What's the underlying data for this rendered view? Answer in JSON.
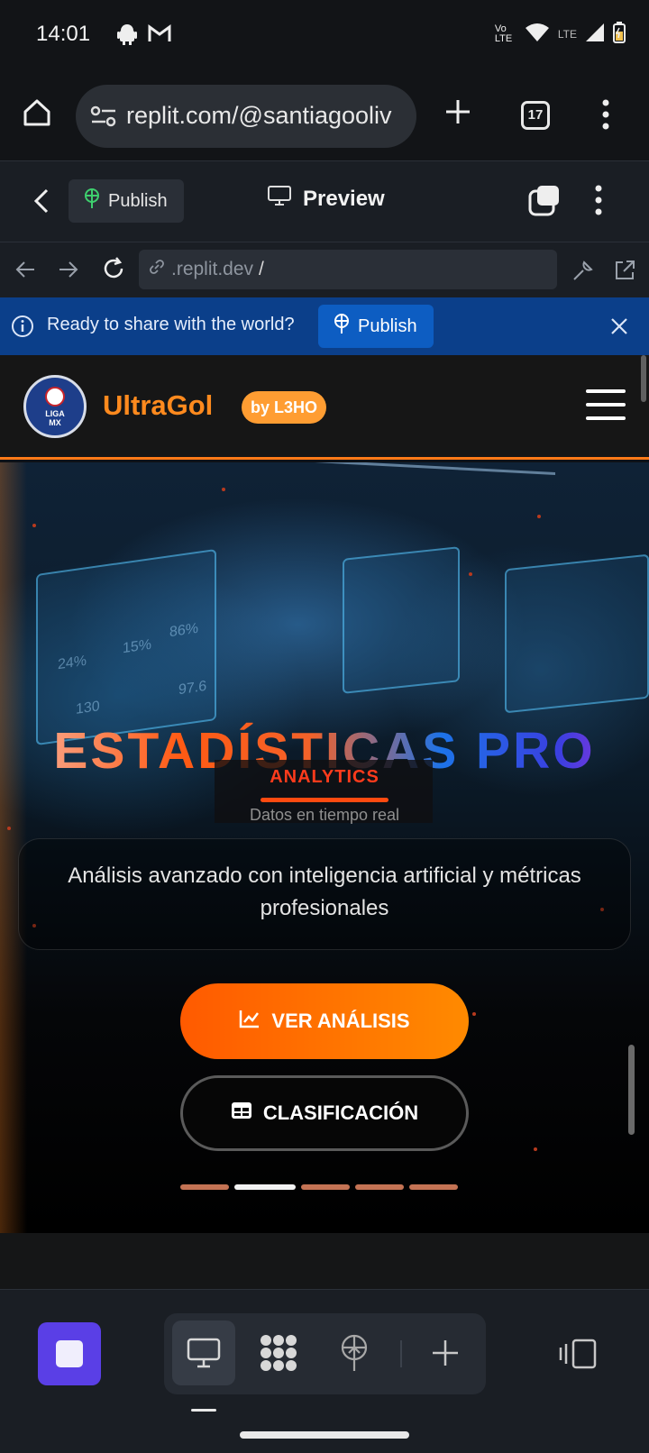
{
  "status_bar": {
    "time": "14:01",
    "network_label": "LTE",
    "volte_label": "Vo LTE",
    "icons": [
      "android-icon",
      "gmail-icon",
      "volte-icon",
      "wifi-icon",
      "signal-icon",
      "battery-charging-icon"
    ]
  },
  "browser": {
    "url": "replit.com/@santiagooliv",
    "tab_count": "17",
    "icons": [
      "home-icon",
      "site-settings-icon",
      "new-tab-icon",
      "tabs-icon",
      "more-icon"
    ]
  },
  "replit_header": {
    "publish_label": "Publish",
    "preview_label": "Preview"
  },
  "preview_nav": {
    "address": ".replit.dev",
    "address_suffix": "/"
  },
  "banner": {
    "text": "Ready to share with the world?",
    "publish_label": "Publish"
  },
  "site_nav": {
    "logo_text_1": "LIGA",
    "logo_text_2": "MX",
    "brand": "UltraGol",
    "badge": "by L3HO"
  },
  "hero": {
    "title": "ESTADÍSTICAS PRO",
    "tag": "ANALYTICS",
    "subtitle": "Datos en tiempo real",
    "description": "Análisis avanzado con inteligencia artificial y métricas profesionales",
    "primary_button": "VER ANÁLISIS",
    "secondary_button": "CLASIFICACIÓN",
    "slide_count": 5,
    "active_slide": 2,
    "background_stats": [
      "24%",
      "15%",
      "86%",
      "130",
      "97.6"
    ]
  },
  "colors": {
    "accent_orange": "#ff7a18",
    "banner_blue": "#0b3f8a",
    "stop_purple": "#5a3fe6"
  }
}
